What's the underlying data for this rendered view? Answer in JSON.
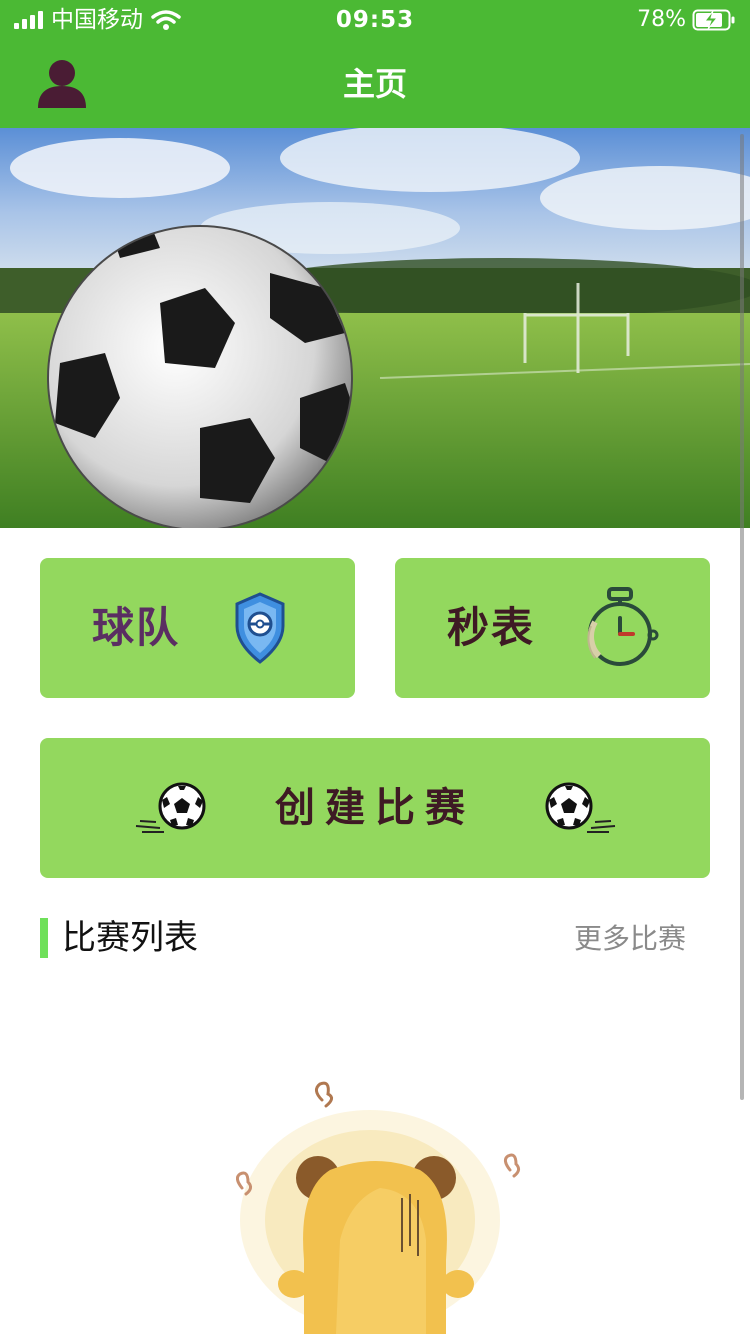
{
  "status_bar": {
    "carrier": "中国移动",
    "time": "09:53",
    "battery_percent": "78%",
    "battery_charging": true,
    "signal_bars": 4
  },
  "nav": {
    "title": "主页",
    "profile_icon": "user-icon"
  },
  "banner": {
    "image": "soccer-ball-on-field"
  },
  "cards": {
    "team_label": "球队",
    "team_icon": "shield-pokeball-icon",
    "stopwatch_label": "秒表",
    "stopwatch_icon": "stopwatch-icon",
    "create_label": "创建比赛",
    "create_icon": "soccer-ball-icon"
  },
  "section": {
    "title": "比赛列表",
    "more_label": "更多比赛"
  },
  "empty_state": {
    "illustration": "bear-illustration"
  },
  "colors": {
    "header": "#4bb934",
    "card": "#93d85e",
    "accent_bar": "#6fe05a"
  }
}
